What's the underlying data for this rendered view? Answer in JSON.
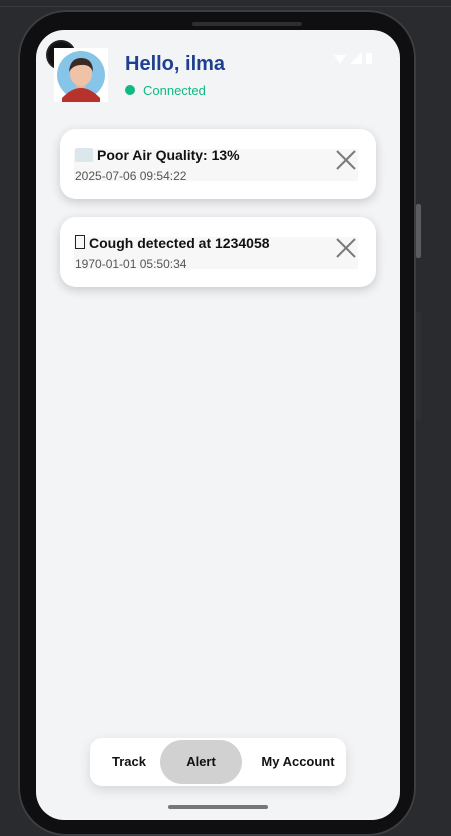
{
  "header": {
    "greeting": "Hello, ilma",
    "status": "Connected",
    "status_color": "#10b981",
    "greeting_color": "#1f3f8f"
  },
  "alerts": [
    {
      "icon": "smog-icon",
      "title": "Poor Air Quality: 13%",
      "timestamp": "2025-07-06 09:54:22"
    },
    {
      "icon": "missing-glyph-icon",
      "title": "Cough detected at 1234058",
      "timestamp": "1970-01-01 05:50:34"
    }
  ],
  "bottom_nav": {
    "items": [
      {
        "label": "Track"
      },
      {
        "label": "Alert",
        "active": true
      },
      {
        "label": "My Account"
      }
    ]
  }
}
